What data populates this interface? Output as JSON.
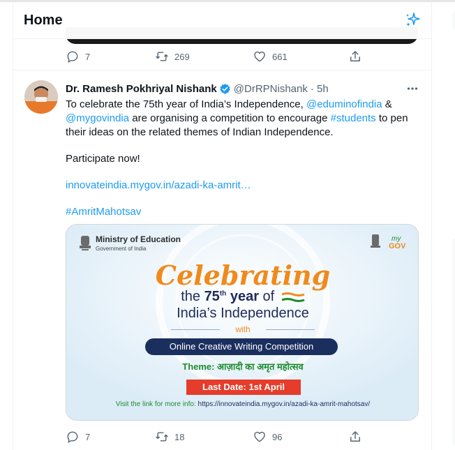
{
  "header": {
    "title": "Home"
  },
  "prev_tweet": {
    "actions": {
      "replies": "7",
      "retweets": "269",
      "likes": "661"
    }
  },
  "tweet": {
    "author": "Dr. Ramesh Pokhriyal Nishank",
    "handle": "@DrRPNishank",
    "time": "· 5h",
    "text": {
      "part1": "To celebrate the 75th year of India’s Independence, ",
      "mention1": "@eduminofindia",
      "part2": " & ",
      "mention2": "@mygovindia",
      "part3": " are organising a competition to encourage ",
      "hashtag1": "#students",
      "part4": " to pen their ideas on the related themes of Indian Independence.",
      "participate": "Participate now!",
      "link": "innovateindia.mygov.in/azadi-ka-amrit…",
      "hashtag2": "#AmritMahotsav"
    },
    "card": {
      "ministry": "Ministry of Education",
      "government": "Government of India",
      "mygov_my": "my",
      "mygov_gov": "GOV",
      "celebrating": "Celebrating",
      "the": "the ",
      "year_num": "75",
      "year_sup": "th",
      "year_word": " year",
      "of": " of",
      "independence": "India’s Independence",
      "with": "with",
      "competition": "Online Creative Writing Competition",
      "theme_label": "Theme: ",
      "theme_value": "आज़ादी का अमृत महोत्सव",
      "last_date": "Last Date: 1st April",
      "visit_label": "Visit the link for more info: ",
      "visit_url": "https://innovateindia.mygov.in/azadi-ka-amrit-mahotsav/"
    },
    "actions": {
      "replies": "7",
      "retweets": "18",
      "likes": "96"
    }
  },
  "colors": {
    "accent": "#1d9bf0",
    "text": "#0f1419",
    "muted": "#536471",
    "orange": "#f08a1c",
    "navy": "#1a2f5e",
    "green": "#1b8a2e",
    "red": "#e53c2b"
  },
  "icons": [
    "sparkle-icon",
    "reply-icon",
    "retweet-icon",
    "like-icon",
    "share-icon",
    "verified-icon",
    "more-icon"
  ]
}
